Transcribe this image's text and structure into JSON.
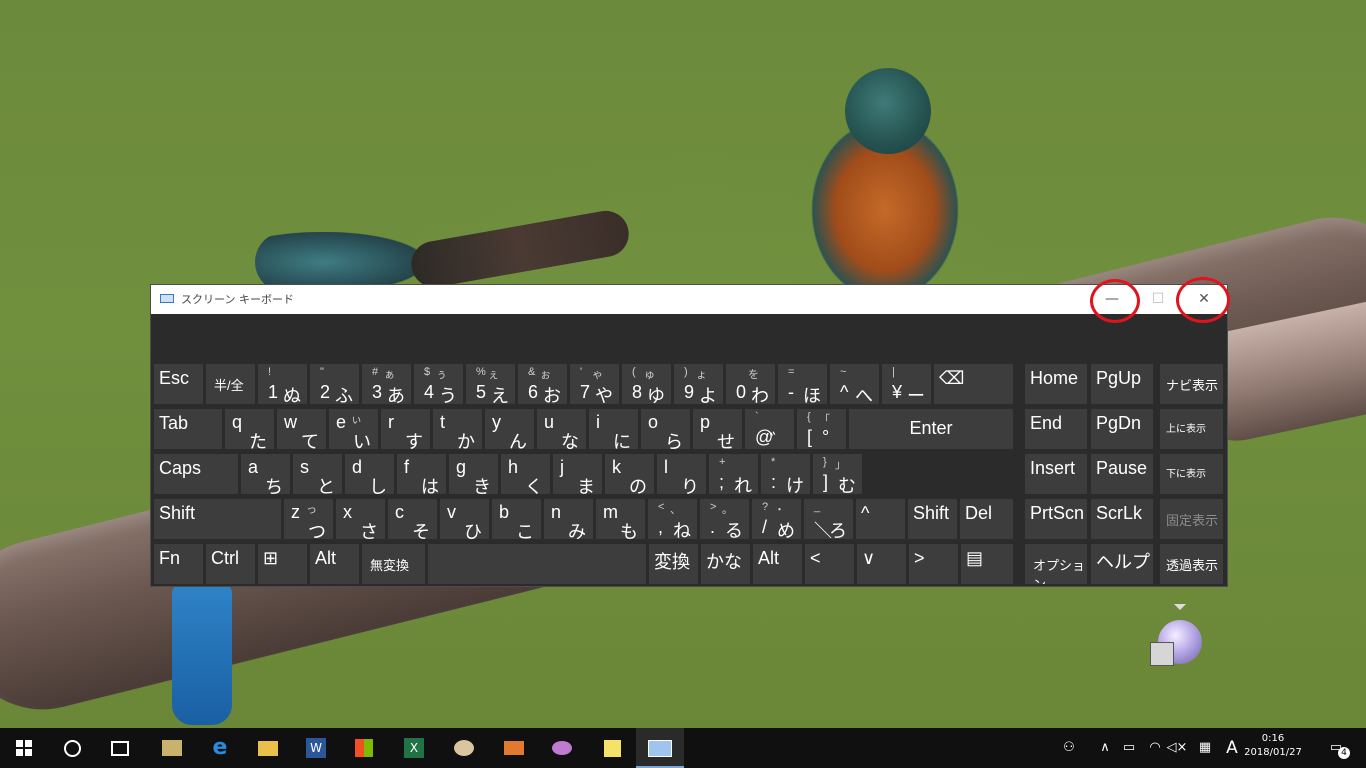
{
  "window": {
    "title": "スクリーン キーボード",
    "minimize_glyph": "—",
    "maximize_glyph": "☐",
    "close_glyph": "✕"
  },
  "rows": {
    "r1": [
      {
        "label": "Esc"
      },
      {
        "label": "半/全"
      },
      {
        "shift": "!",
        "main": "1",
        "kana": "ぬ"
      },
      {
        "shift": "\"",
        "main": "2",
        "kana": "ふ"
      },
      {
        "shift": "#",
        "kana_shift": "ぁ",
        "main": "3",
        "kana": "あ"
      },
      {
        "shift": "$",
        "kana_shift": "ぅ",
        "main": "4",
        "kana": "う"
      },
      {
        "shift": "%",
        "kana_shift": "ぇ",
        "main": "5",
        "kana": "え"
      },
      {
        "shift": "&",
        "kana_shift": "ぉ",
        "main": "6",
        "kana": "お"
      },
      {
        "shift": "'",
        "kana_shift": "ゃ",
        "main": "7",
        "kana": "や"
      },
      {
        "shift": "(",
        "kana_shift": "ゅ",
        "main": "8",
        "kana": "ゆ"
      },
      {
        "shift": ")",
        "kana_shift": "ょ",
        "main": "9",
        "kana": "よ"
      },
      {
        "kana_shift": "を",
        "main": "0",
        "kana": "わ"
      },
      {
        "shift": "=",
        "main": "-",
        "kana": "ほ"
      },
      {
        "shift": "~",
        "main": "^",
        "kana": "へ"
      },
      {
        "shift": "|",
        "main": "¥",
        "kana": "ー"
      },
      {
        "label": "⌫"
      }
    ],
    "r2": [
      {
        "label": "Tab"
      },
      {
        "letter": "q",
        "kana": "た"
      },
      {
        "letter": "w",
        "kana": "て"
      },
      {
        "letter": "e",
        "kana_shift": "ぃ",
        "kana": "い"
      },
      {
        "letter": "r",
        "kana": "す"
      },
      {
        "letter": "t",
        "kana": "か"
      },
      {
        "letter": "y",
        "kana": "ん"
      },
      {
        "letter": "u",
        "kana": "な"
      },
      {
        "letter": "i",
        "kana": "に"
      },
      {
        "letter": "o",
        "kana": "ら"
      },
      {
        "letter": "p",
        "kana": "せ"
      },
      {
        "shift": "`",
        "main": "@",
        "kana": "゛"
      },
      {
        "shift": "{",
        "kana_shift": "「",
        "main": "[",
        "kana": "°"
      },
      {
        "label": "Enter"
      }
    ],
    "r3": [
      {
        "label": "Caps"
      },
      {
        "letter": "a",
        "kana": "ち"
      },
      {
        "letter": "s",
        "kana": "と"
      },
      {
        "letter": "d",
        "kana": "し"
      },
      {
        "letter": "f",
        "kana": "は"
      },
      {
        "letter": "g",
        "kana": "き"
      },
      {
        "letter": "h",
        "kana": "く"
      },
      {
        "letter": "j",
        "kana": "ま"
      },
      {
        "letter": "k",
        "kana": "の"
      },
      {
        "letter": "l",
        "kana": "り"
      },
      {
        "shift": "+",
        "main": ";",
        "kana": "れ"
      },
      {
        "shift": "*",
        "main": ":",
        "kana": "け"
      },
      {
        "shift": "}",
        "kana_shift": "」",
        "main": "]",
        "kana": "む"
      }
    ],
    "r4": [
      {
        "label": "Shift"
      },
      {
        "letter": "z",
        "kana_shift": "っ",
        "kana": "つ"
      },
      {
        "letter": "x",
        "kana": "さ"
      },
      {
        "letter": "c",
        "kana": "そ"
      },
      {
        "letter": "v",
        "kana": "ひ"
      },
      {
        "letter": "b",
        "kana": "こ"
      },
      {
        "letter": "n",
        "kana": "み"
      },
      {
        "letter": "m",
        "kana": "も"
      },
      {
        "shift": "<",
        "kana_shift": "、",
        "main": ",",
        "kana": "ね"
      },
      {
        "shift": ">",
        "kana_shift": "。",
        "main": ".",
        "kana": "る"
      },
      {
        "shift": "?",
        "kana_shift": "・",
        "main": "/",
        "kana": "め"
      },
      {
        "shift": "_",
        "main": "＼",
        "kana": "ろ"
      },
      {
        "label": "^"
      },
      {
        "label": "Shift"
      },
      {
        "label": "Del"
      }
    ],
    "r5": [
      {
        "label": "Fn"
      },
      {
        "label": "Ctrl"
      },
      {
        "label": "⊞"
      },
      {
        "label": "Alt"
      },
      {
        "label": "無変換"
      },
      {
        "label": ""
      },
      {
        "label": "変換"
      },
      {
        "label": "かな"
      },
      {
        "label": "Alt"
      },
      {
        "label": "<"
      },
      {
        "label": "∨"
      },
      {
        "label": ">"
      },
      {
        "label": "▤"
      }
    ]
  },
  "nav_keys": {
    "home": "Home",
    "pgup": "PgUp",
    "end": "End",
    "pgdn": "PgDn",
    "insert": "Insert",
    "pause": "Pause",
    "prtscn": "PrtScn",
    "scrlk": "ScrLk",
    "options": "オプション",
    "help": "ヘルプ"
  },
  "side_keys": {
    "nav": "ナビ表示",
    "up": "上に表示",
    "down": "下に表示",
    "fix": "固定表示",
    "transparent": "透過表示"
  },
  "taskbar": {
    "ime_mode": "A",
    "time": "0:16",
    "date": "2018/01/27",
    "notification_count": "4"
  },
  "colors": {
    "key_bg": "#3d3d3d",
    "osk_bg": "#2b2b2b",
    "highlight_ring": "#e0141e",
    "taskbar": "#101010"
  }
}
